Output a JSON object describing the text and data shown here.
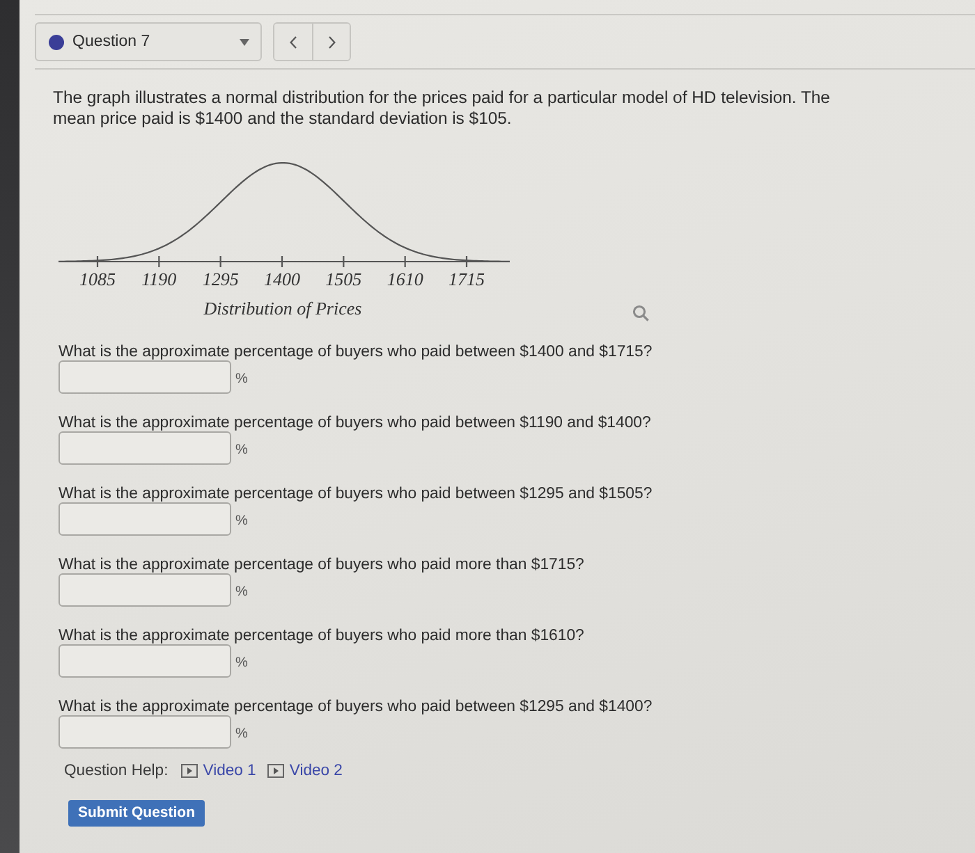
{
  "question_selector": {
    "label": "Question 7"
  },
  "prompt": "The graph illustrates a normal distribution for the prices paid for a particular model of HD television. The mean price paid is $1400 and the standard deviation is $105.",
  "graph": {
    "tick_labels": [
      "1085",
      "1190",
      "1295",
      "1400",
      "1505",
      "1610",
      "1715"
    ],
    "caption": "Distribution of Prices"
  },
  "questions": [
    {
      "text": "What is the approximate percentage of buyers who paid between $1400 and $1715?",
      "unit": "%"
    },
    {
      "text": "What is the approximate percentage of buyers who paid between $1190 and $1400?",
      "unit": "%"
    },
    {
      "text": "What is the approximate percentage of buyers who paid between $1295 and $1505?",
      "unit": "%"
    },
    {
      "text": "What is the approximate percentage of buyers who paid more than $1715?",
      "unit": "%"
    },
    {
      "text": "What is the approximate percentage of buyers who paid more than $1610?",
      "unit": "%"
    },
    {
      "text": "What is the approximate percentage of buyers who paid between $1295 and $1400?",
      "unit": "%"
    }
  ],
  "help": {
    "label": "Question Help:",
    "links": [
      "Video 1",
      "Video 2"
    ]
  },
  "submit_button": "Submit Question"
}
